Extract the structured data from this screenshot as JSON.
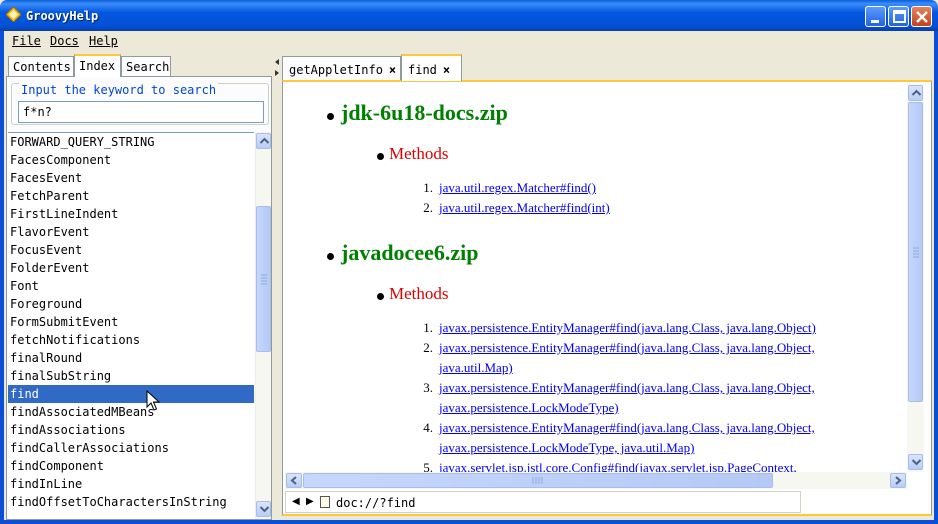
{
  "window": {
    "title": "GroovyHelp"
  },
  "menu": {
    "file": "File",
    "docs": "Docs",
    "help": "Help"
  },
  "left_tabs": {
    "contents": "Contents",
    "index": "Index",
    "search": "Search"
  },
  "search": {
    "label": "Input the keyword to search",
    "value": "f*n?"
  },
  "index_list": [
    "FORWARD_QUERY_STRING",
    "FacesComponent",
    "FacesEvent",
    "FetchParent",
    "FirstLineIndent",
    "FlavorEvent",
    "FocusEvent",
    "FolderEvent",
    "Font",
    "Foreground",
    "FormSubmitEvent",
    "fetchNotifications",
    "finalRound",
    "finalSubString",
    "find",
    "findAssociatedMBeans",
    "findAssociations",
    "findCallerAssociations",
    "findComponent",
    "findInLine",
    "findOffsetToCharactersInString"
  ],
  "selected_index_item": "find",
  "doc_tabs": [
    {
      "label": "getAppletInfo",
      "close": "×"
    },
    {
      "label": "find",
      "close": "×"
    }
  ],
  "content": {
    "sections": [
      {
        "title": "jdk-6u18-docs.zip",
        "heading": "Methods",
        "items": [
          {
            "num": "1.",
            "lines": [
              "java.util.regex.Matcher#find()"
            ]
          },
          {
            "num": "2.",
            "lines": [
              "java.util.regex.Matcher#find(int)"
            ]
          }
        ]
      },
      {
        "title": "javadocee6.zip",
        "heading": "Methods",
        "items": [
          {
            "num": "1.",
            "lines": [
              "javax.persistence.EntityManager#find(java.lang.Class, java.lang.Object)"
            ]
          },
          {
            "num": "2.",
            "lines": [
              "javax.persistence.EntityManager#find(java.lang.Class, java.lang.Object,",
              "java.util.Map)"
            ]
          },
          {
            "num": "3.",
            "lines": [
              "javax.persistence.EntityManager#find(java.lang.Class, java.lang.Object,",
              "javax.persistence.LockModeType)"
            ]
          },
          {
            "num": "4.",
            "lines": [
              "javax.persistence.EntityManager#find(java.lang.Class, java.lang.Object,",
              "javax.persistence.LockModeType, java.util.Map)"
            ]
          },
          {
            "num": "5.",
            "lines": [
              "javax.servlet.jsp.jstl.core.Config#find(javax.servlet.jsp.PageContext,"
            ]
          }
        ]
      }
    ]
  },
  "address": {
    "back": "◀",
    "forward": "▶",
    "url": "doc://?find"
  }
}
